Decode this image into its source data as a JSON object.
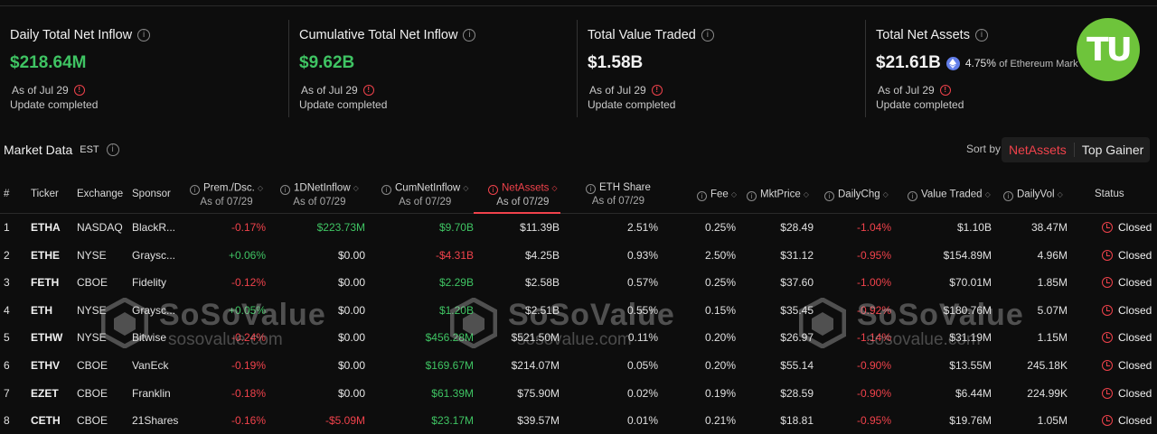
{
  "cards": [
    {
      "title": "Daily Total Net Inflow",
      "value": "$218.64M",
      "color": "#3fc463",
      "asof": "As of Jul 29",
      "update": "Update completed"
    },
    {
      "title": "Cumulative Total Net Inflow",
      "value": "$9.62B",
      "color": "#3fc463",
      "asof": "As of Jul 29",
      "update": "Update completed"
    },
    {
      "title": "Total Value Traded",
      "value": "$1.58B",
      "color": "#f2f2f2",
      "asof": "As of Jul 29",
      "update": "Update completed"
    },
    {
      "title": "Total Net Assets",
      "value": "$21.61B",
      "color": "#f2f2f2",
      "share": "4.75%",
      "share_label": "of Ethereum Mark",
      "asof": "As of Jul 29",
      "update": "Update completed"
    }
  ],
  "logo_text": "TU",
  "market": {
    "title": "Market Data",
    "timezone": "EST",
    "sort_label": "Sort by",
    "sort_active": "NetAssets",
    "sort_other": "Top Gainer"
  },
  "headers": {
    "num": "#",
    "ticker": "Ticker",
    "exchange": "Exchange",
    "sponsor": "Sponsor",
    "prem": "Prem./Dsc.",
    "inflow": "1DNetInflow",
    "cum": "CumNetInflow",
    "assets": "NetAssets",
    "share": "ETH Share",
    "fee": "Fee",
    "price": "MktPrice",
    "chg": "DailyChg",
    "traded": "Value Traded",
    "vol": "DailyVol",
    "status": "Status",
    "asof": "As of 07/29"
  },
  "rows": [
    {
      "n": "1",
      "ticker": "ETHA",
      "exchange": "NASDAQ",
      "sponsor": "BlackR...",
      "prem": "-0.17%",
      "inflow": "$223.73M",
      "cum": "$9.70B",
      "assets": "$11.39B",
      "share": "2.51%",
      "fee": "0.25%",
      "price": "$28.49",
      "chg": "-1.04%",
      "traded": "$1.10B",
      "vol": "38.47M",
      "status": "Closed",
      "prem_c": "#f0424b",
      "inflow_c": "#3fc463",
      "cum_c": "#3fc463",
      "chg_c": "#f0424b"
    },
    {
      "n": "2",
      "ticker": "ETHE",
      "exchange": "NYSE",
      "sponsor": "Graysc...",
      "prem": "+0.06%",
      "inflow": "$0.00",
      "cum": "-$4.31B",
      "assets": "$4.25B",
      "share": "0.93%",
      "fee": "2.50%",
      "price": "$31.12",
      "chg": "-0.95%",
      "traded": "$154.89M",
      "vol": "4.96M",
      "status": "Closed",
      "prem_c": "#3fc463",
      "inflow_c": "#e6e6e6",
      "cum_c": "#f0424b",
      "chg_c": "#f0424b"
    },
    {
      "n": "3",
      "ticker": "FETH",
      "exchange": "CBOE",
      "sponsor": "Fidelity",
      "prem": "-0.12%",
      "inflow": "$0.00",
      "cum": "$2.29B",
      "assets": "$2.58B",
      "share": "0.57%",
      "fee": "0.25%",
      "price": "$37.60",
      "chg": "-1.00%",
      "traded": "$70.01M",
      "vol": "1.85M",
      "status": "Closed",
      "prem_c": "#f0424b",
      "inflow_c": "#e6e6e6",
      "cum_c": "#3fc463",
      "chg_c": "#f0424b"
    },
    {
      "n": "4",
      "ticker": "ETH",
      "exchange": "NYSE",
      "sponsor": "Graysc...",
      "prem": "+0.05%",
      "inflow": "$0.00",
      "cum": "$1.20B",
      "assets": "$2.51B",
      "share": "0.55%",
      "fee": "0.15%",
      "price": "$35.45",
      "chg": "-0.92%",
      "traded": "$180.76M",
      "vol": "5.07M",
      "status": "Closed",
      "prem_c": "#3fc463",
      "inflow_c": "#e6e6e6",
      "cum_c": "#3fc463",
      "chg_c": "#f0424b"
    },
    {
      "n": "5",
      "ticker": "ETHW",
      "exchange": "NYSE",
      "sponsor": "Bitwise",
      "prem": "-0.24%",
      "inflow": "$0.00",
      "cum": "$456.28M",
      "assets": "$521.50M",
      "share": "0.11%",
      "fee": "0.20%",
      "price": "$26.97",
      "chg": "-1.14%",
      "traded": "$31.19M",
      "vol": "1.15M",
      "status": "Closed",
      "prem_c": "#f0424b",
      "inflow_c": "#e6e6e6",
      "cum_c": "#3fc463",
      "chg_c": "#f0424b"
    },
    {
      "n": "6",
      "ticker": "ETHV",
      "exchange": "CBOE",
      "sponsor": "VanEck",
      "prem": "-0.19%",
      "inflow": "$0.00",
      "cum": "$169.67M",
      "assets": "$214.07M",
      "share": "0.05%",
      "fee": "0.20%",
      "price": "$55.14",
      "chg": "-0.90%",
      "traded": "$13.55M",
      "vol": "245.18K",
      "status": "Closed",
      "prem_c": "#f0424b",
      "inflow_c": "#e6e6e6",
      "cum_c": "#3fc463",
      "chg_c": "#f0424b"
    },
    {
      "n": "7",
      "ticker": "EZET",
      "exchange": "CBOE",
      "sponsor": "Franklin",
      "prem": "-0.18%",
      "inflow": "$0.00",
      "cum": "$61.39M",
      "assets": "$75.90M",
      "share": "0.02%",
      "fee": "0.19%",
      "price": "$28.59",
      "chg": "-0.90%",
      "traded": "$6.44M",
      "vol": "224.99K",
      "status": "Closed",
      "prem_c": "#f0424b",
      "inflow_c": "#e6e6e6",
      "cum_c": "#3fc463",
      "chg_c": "#f0424b"
    },
    {
      "n": "8",
      "ticker": "CETH",
      "exchange": "CBOE",
      "sponsor": "21Shares",
      "prem": "-0.16%",
      "inflow": "-$5.09M",
      "cum": "$23.17M",
      "assets": "$39.57M",
      "share": "0.01%",
      "fee": "0.21%",
      "price": "$18.81",
      "chg": "-0.95%",
      "traded": "$19.76M",
      "vol": "1.05M",
      "status": "Closed",
      "prem_c": "#f0424b",
      "inflow_c": "#f0424b",
      "cum_c": "#3fc463",
      "chg_c": "#f0424b"
    }
  ],
  "watermark": {
    "name": "SoSoValue",
    "url": "sosovalue.com"
  }
}
